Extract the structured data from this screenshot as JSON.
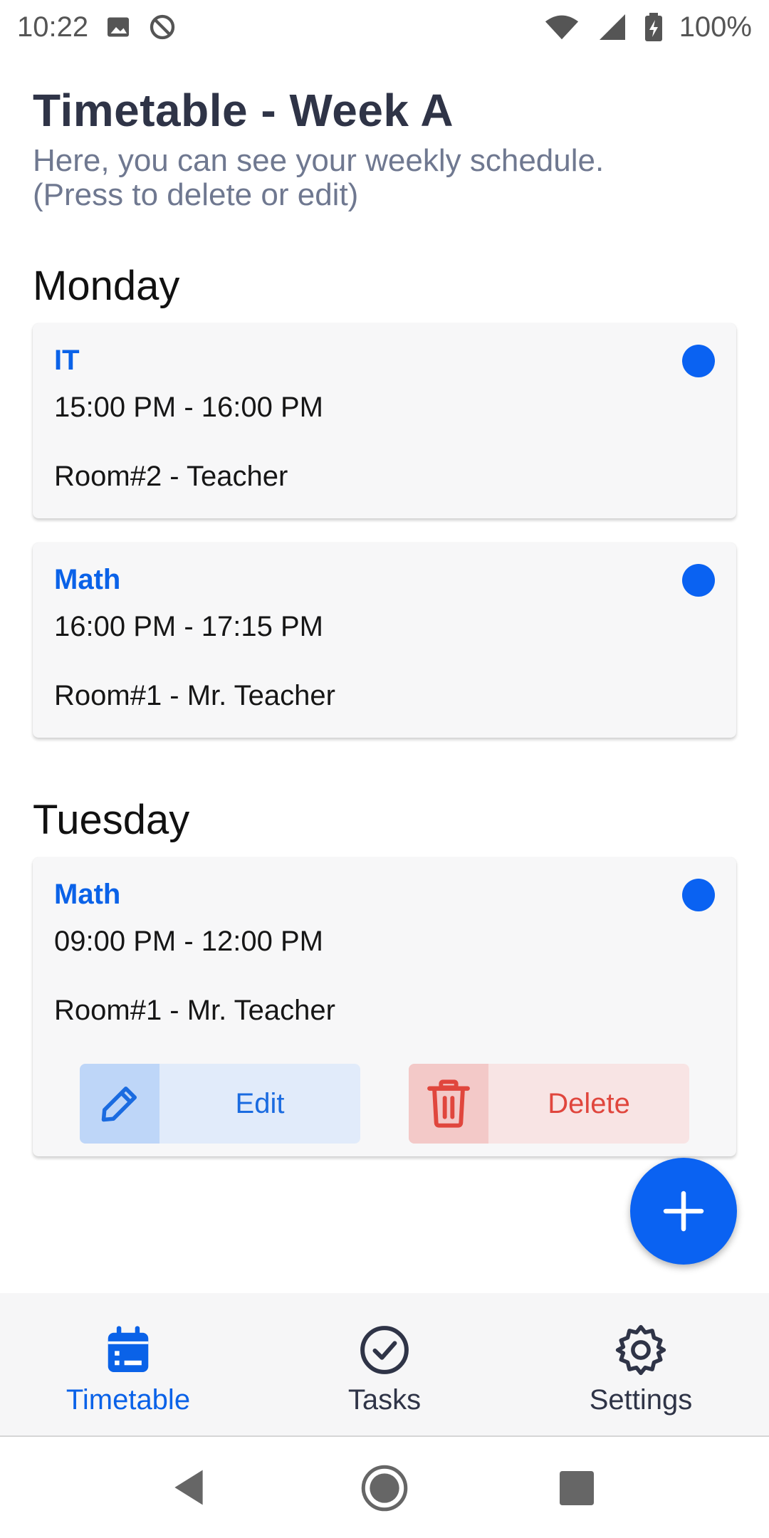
{
  "status_bar": {
    "time": "10:22",
    "battery": "100%",
    "icons": [
      "image-icon",
      "do-not-disturb-icon",
      "wifi-icon",
      "signal-icon",
      "battery-icon"
    ]
  },
  "header": {
    "title": "Timetable - Week A",
    "subtitle_line1": "Here, you can see your weekly schedule.",
    "subtitle_line2": "(Press to delete or edit)"
  },
  "days": [
    {
      "name": "Monday",
      "entries": [
        {
          "subject": "IT",
          "time": "15:00 PM - 16:00 PM",
          "room": "Room#2 - Teacher"
        },
        {
          "subject": "Math",
          "time": "16:00 PM - 17:15 PM",
          "room": "Room#1 - Mr. Teacher"
        }
      ]
    },
    {
      "name": "Tuesday",
      "entries": [
        {
          "subject": "Math",
          "time": "09:00 PM - 12:00 PM",
          "room": "Room#1 - Mr. Teacher"
        }
      ]
    }
  ],
  "actions": {
    "edit_label": "Edit",
    "delete_label": "Delete"
  },
  "bottom_nav": {
    "items": [
      {
        "label": "Timetable",
        "icon": "calendar-icon",
        "active": true
      },
      {
        "label": "Tasks",
        "icon": "check-circle-icon",
        "active": false
      },
      {
        "label": "Settings",
        "icon": "gear-icon",
        "active": false
      }
    ]
  },
  "colors": {
    "accent": "#0a62f2",
    "title": "#2f3447",
    "subtitle": "#6f7890",
    "delete": "#e0463d"
  }
}
